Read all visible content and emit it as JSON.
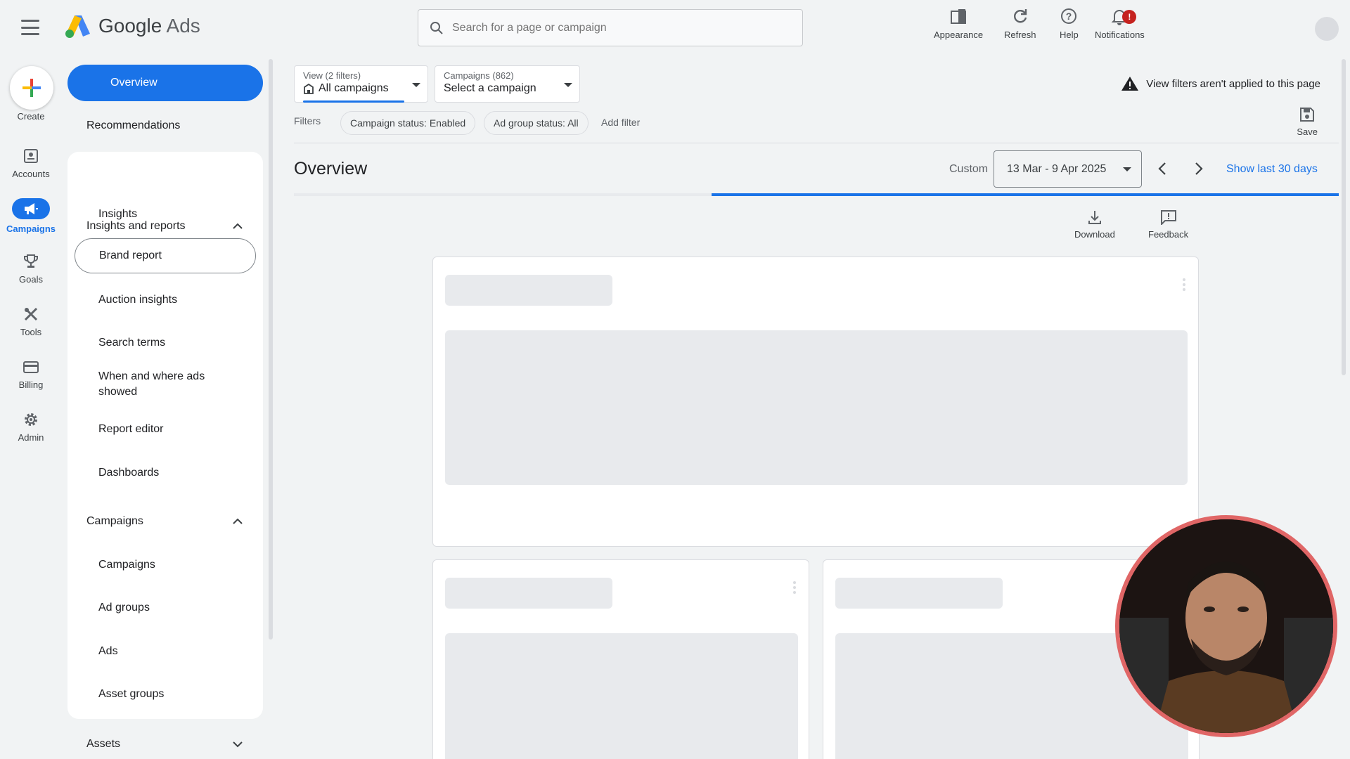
{
  "app": {
    "logo_word1": "Google",
    "logo_word2": "Ads"
  },
  "search": {
    "placeholder": "Search for a page or campaign"
  },
  "top_actions": {
    "appearance": "Appearance",
    "refresh": "Refresh",
    "help": "Help",
    "notifications": "Notifications",
    "notifications_badge": "!"
  },
  "rail": {
    "create": "Create",
    "accounts": "Accounts",
    "campaigns": "Campaigns",
    "goals": "Goals",
    "tools": "Tools",
    "billing": "Billing",
    "admin": "Admin"
  },
  "nav": {
    "overview": "Overview",
    "recommendations": "Recommendations",
    "insights_reports": {
      "header": "Insights and reports",
      "items": [
        "Insights",
        "Brand report",
        "Auction insights",
        "Search terms",
        "When and where ads showed",
        "Report editor",
        "Dashboards"
      ]
    },
    "campaigns": {
      "header": "Campaigns",
      "items": [
        "Campaigns",
        "Ad groups",
        "Ads",
        "Asset groups"
      ]
    },
    "assets": {
      "header": "Assets"
    }
  },
  "view_filter": {
    "label": "View (2 filters)",
    "value": "All campaigns"
  },
  "campaign_filter": {
    "label": "Campaigns (862)",
    "value": "Select a campaign"
  },
  "warning": "View filters aren't applied to this page",
  "filters": {
    "label": "Filters",
    "chips": [
      "Campaign status: Enabled",
      "Ad group status: All"
    ],
    "add": "Add filter"
  },
  "save": "Save",
  "page": {
    "title": "Overview",
    "date_mode": "Custom",
    "date_range": "13 Mar - 9 Apr 2025",
    "show_last": "Show last 30 days",
    "loading_progress": 0.6
  },
  "card_actions": {
    "download": "Download",
    "feedback": "Feedback"
  },
  "colors": {
    "accent": "#1a73e8",
    "badge": "#c5221f",
    "webcam_ring": "#e06666"
  }
}
